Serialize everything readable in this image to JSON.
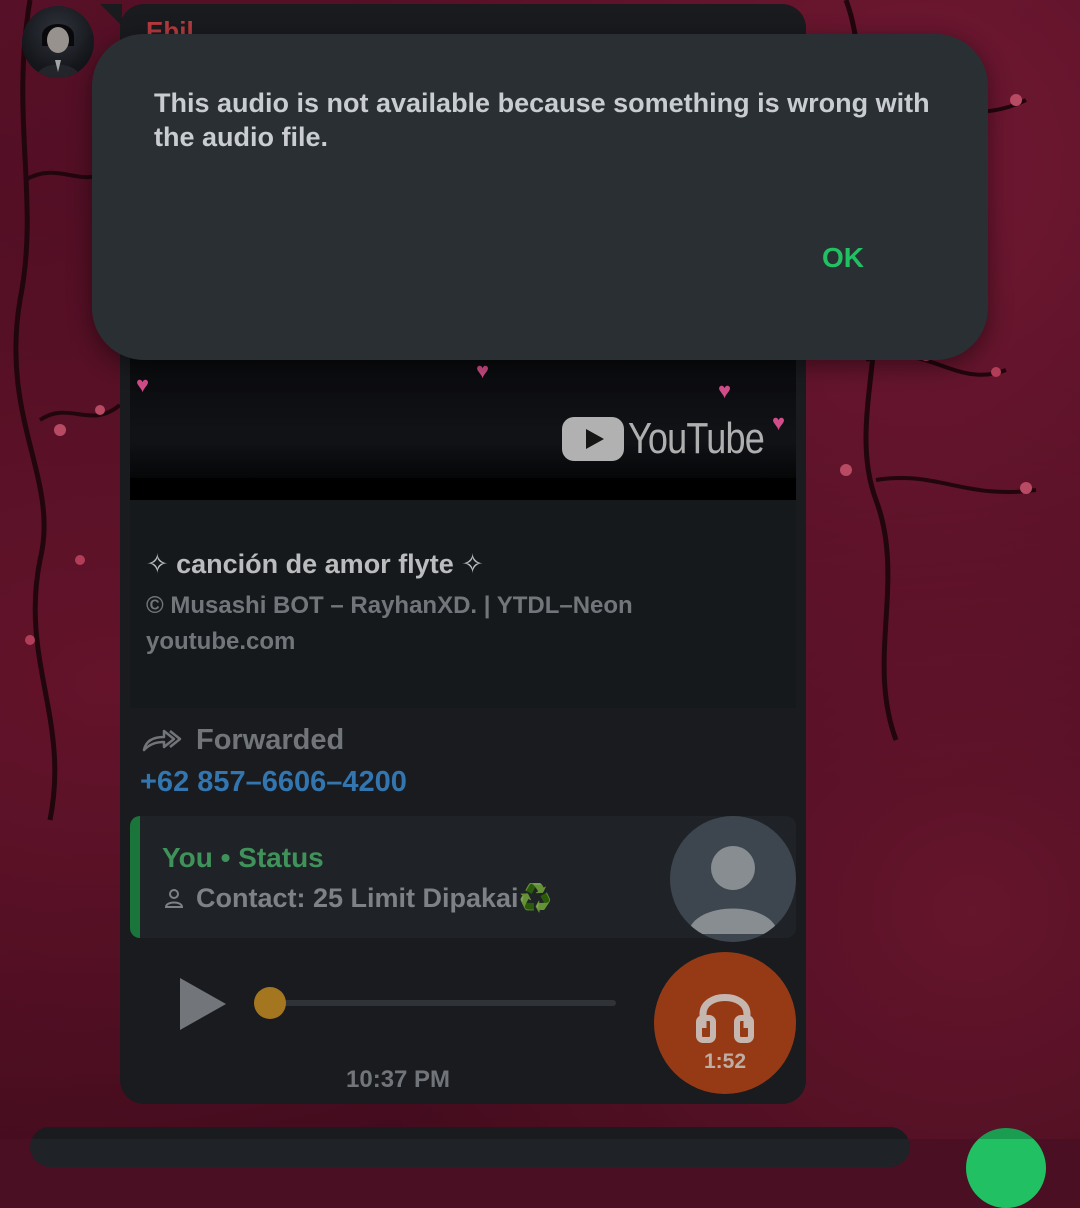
{
  "colors": {
    "accent": "#21c063",
    "sender_name": "#e0484e",
    "phone_link": "#3e8fd6",
    "quote_bar": "#1f8f46",
    "progress_knob": "#c89126",
    "audio_avatar": "#b8471c",
    "dialog_bg": "#2a2f34",
    "bubble_bg": "#1f2226"
  },
  "message": {
    "sender": "Ebil",
    "link_preview": {
      "thumbnail_logo_text": "YouTube",
      "title": "✧ canción de amor flyte ✧",
      "description": "© Musashi BOT – RayhanXD. | YTDL–Neon",
      "domain": "youtube.com"
    },
    "forwarded_label": "Forwarded",
    "phone": "+62 857–6606–4200",
    "quoted": {
      "title": "You • Status",
      "body": "Contact: 25 Limit Dipakai♻️"
    },
    "audio": {
      "duration": "1:52",
      "progress": 0
    },
    "time": "10:37 PM"
  },
  "dialog": {
    "message": "This audio is not available because something is wrong with the audio file.",
    "ok_label": "OK"
  },
  "icons": {
    "forward": "forward-icon",
    "person": "person-icon",
    "play": "play-icon",
    "headphones": "headphones-icon"
  }
}
